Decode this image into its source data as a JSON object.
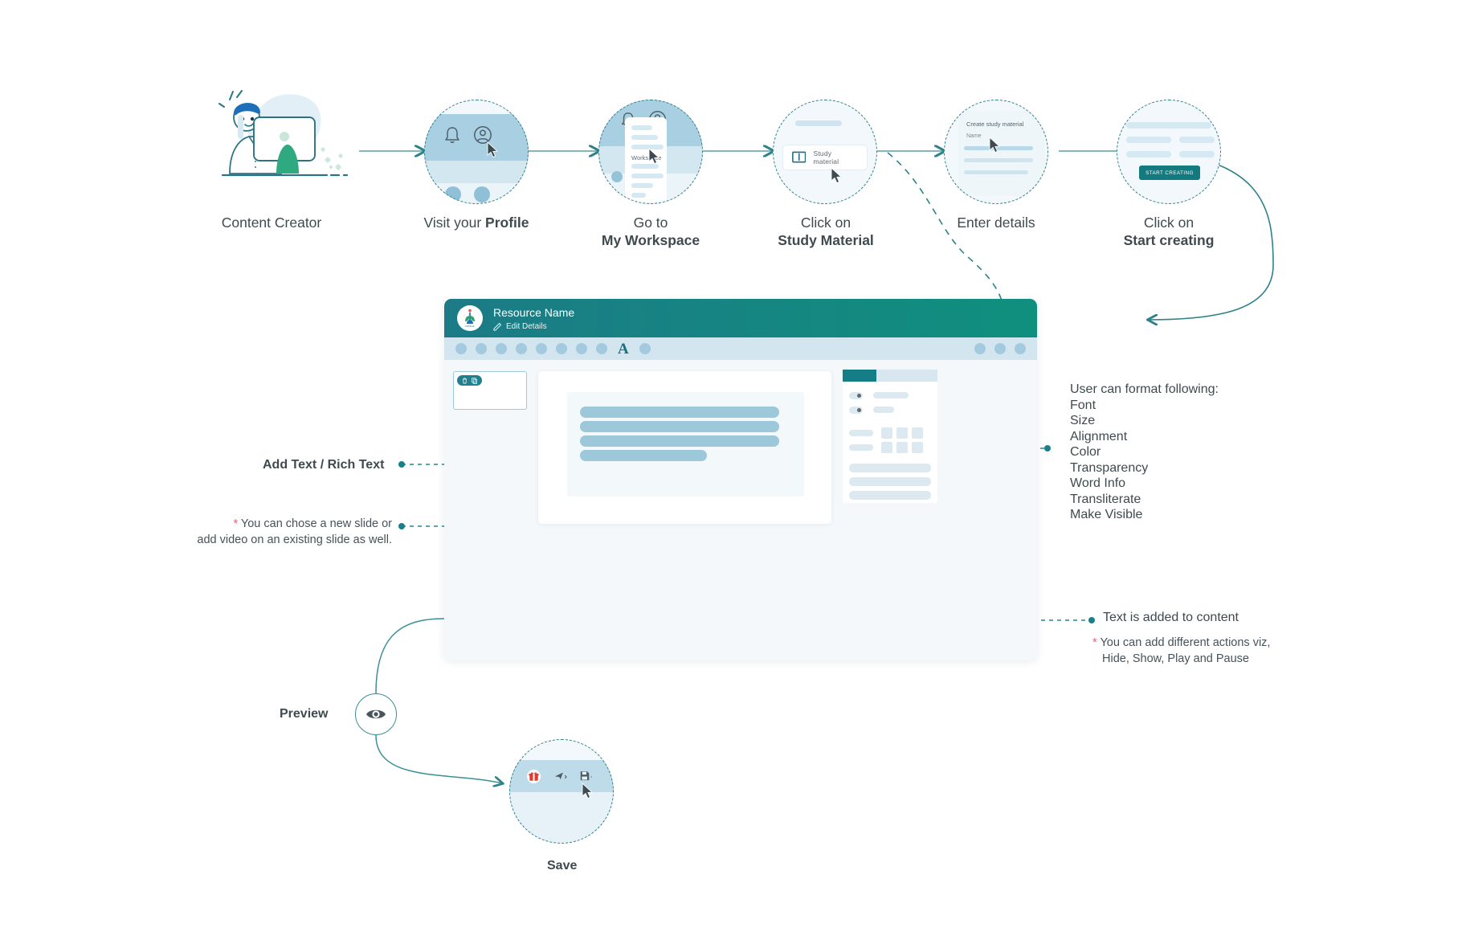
{
  "flow": {
    "steps": [
      {
        "id": "content-creator",
        "line1": "Content Creator",
        "line2": ""
      },
      {
        "id": "visit-profile",
        "line1": "Visit your ",
        "line2": "",
        "bold_inline": "Profile"
      },
      {
        "id": "my-workspace",
        "line1": "Go to",
        "line2": "My Workspace"
      },
      {
        "id": "study-material",
        "line1": "Click on",
        "line2": "Study Material"
      },
      {
        "id": "enter-details",
        "line1": "Enter details",
        "line2": ""
      },
      {
        "id": "start-creating",
        "line1": "Click on",
        "line2": "Start creating"
      }
    ],
    "workspace_thumb_label": "Workspace",
    "study_material_button": "Study material",
    "create_form_title": "Create study material",
    "create_form_field": "Name",
    "start_creating_button": "START CREATING"
  },
  "editor": {
    "title": "Resource Name",
    "edit_details": "Edit Details",
    "logo_text": "DIKSHA",
    "toolbar": {
      "left_icon_count": 8,
      "text_tool_glyph": "A",
      "after_text_icon_count": 1,
      "right_icon_count": 3
    }
  },
  "annotations": {
    "add_text": "Add Text / Rich Text",
    "slide_note_star": "*",
    "slide_note_line1": "You can chose a new slide or",
    "slide_note_line2": "add video on an existing slide as well.",
    "format_heading": "User can format following:",
    "format_options": [
      "Font",
      "Size",
      "Alignment",
      "Color",
      "Transparency",
      "Word Info",
      "Transliterate",
      "Make Visible"
    ],
    "text_added": "Text is added to content",
    "actions_note_star": "*",
    "actions_note_line1": "You can add different actions viz,",
    "actions_note_line2": "Hide, Show, Play and Pause",
    "preview_label": "Preview",
    "save_label": "Save"
  },
  "colors": {
    "teal": "#17808a",
    "teal_dark": "#1c7b86",
    "green": "#0f8f7e",
    "line": "#63a9ac",
    "light_blue": "#a8cfe2",
    "pale_blue": "#d3e7f1",
    "panel_bg": "#f4f8fb",
    "accent_red": "#e23b2e",
    "star_pink": "#e8637c",
    "text": "#3f4a4f"
  }
}
